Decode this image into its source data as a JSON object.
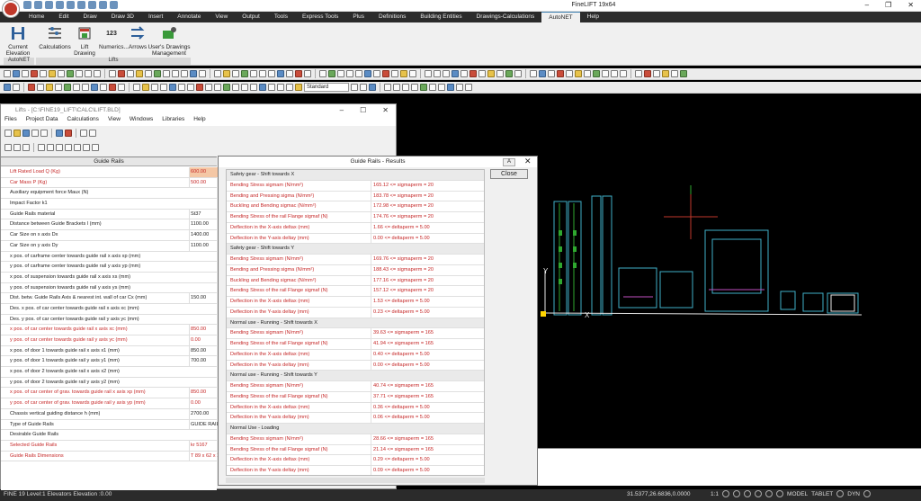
{
  "app": {
    "title": "FineLIFT 19x64"
  },
  "ribbon": {
    "tabs": [
      "Home",
      "Edit",
      "Draw",
      "Draw 3D",
      "Insert",
      "Annotate",
      "View",
      "Output",
      "Tools",
      "Express Tools",
      "Plus",
      "Definitions",
      "Building Entities",
      "Drawings-Calculations",
      "AutoNET",
      "Help"
    ],
    "active_tab": "AutoNET",
    "buttons": [
      "Current Elevation",
      "Calculations",
      "Lift Drawing",
      "Numerics...",
      "Arrows",
      "User's Drawings Management"
    ],
    "groups": [
      "AutoNET",
      "Lifts"
    ]
  },
  "toolbar": {
    "style_combo": "Standard"
  },
  "lifts_window": {
    "title": "Lifts - [C:\\FINE19_LIFT\\CALC\\LIFT.BLD]",
    "menu": [
      "Files",
      "Project Data",
      "Calculations",
      "View",
      "Windows",
      "Libraries",
      "Help"
    ],
    "panel_title": "Guide Rails",
    "rows": [
      {
        "label": "Lift Rated Load Q (Kg)",
        "value": "600.00"
      },
      {
        "label": "Car Mass P (Kg)",
        "value": "500.00"
      },
      {
        "label": "Auxiliary equipment force Maux (N)",
        "value": ""
      },
      {
        "label": "Impact Factor k1",
        "value": ""
      },
      {
        "label": "Guide Rails material",
        "value": "St37"
      },
      {
        "label": "Distance between Guide Brackets l (mm)",
        "value": "1100.00"
      },
      {
        "label": "Car Size on x axis Dx",
        "value": "1400.00"
      },
      {
        "label": "Car Size on y axis Dy",
        "value": "1100.00"
      },
      {
        "label": "x pos. of carframe center towards guide rail x axis xp (mm)",
        "value": ""
      },
      {
        "label": "y pos. of carframe center towards guide rail y axis yp (mm)",
        "value": ""
      },
      {
        "label": "x pos. of suspension towards guide rail x axis xs (mm)",
        "value": ""
      },
      {
        "label": "y pos. of suspension towards guide rail y axis ys (mm)",
        "value": ""
      },
      {
        "label": "Dist. betw. Guide Rails Axis & nearest int. wall of car Cx (mm)",
        "value": "150.00"
      },
      {
        "label": "Des. x pos. of car center towards guide rail x axis xc (mm)",
        "value": ""
      },
      {
        "label": "Des. y pos. of car center towards guide rail y axis yc (mm)",
        "value": ""
      },
      {
        "label": "x pos. of car center towards guide rail x axis xc (mm)",
        "value": "850.00"
      },
      {
        "label": "y pos. of car center towards guide rail y axis yc (mm)",
        "value": "0.00"
      },
      {
        "label": "x pos. of door 1 towards guide rail x axis x1 (mm)",
        "value": "850.00"
      },
      {
        "label": "y pos. of door 1 towards guide rail y axis y1 (mm)",
        "value": "700.00"
      },
      {
        "label": "x pos. of door 2 towards guide rail x axis x2 (mm)",
        "value": ""
      },
      {
        "label": "y pos. of door 2 towards guide rail y axis y2 (mm)",
        "value": ""
      },
      {
        "label": "x pos. of car center of grav. towards guide rail x axis xp (mm)",
        "value": "850.00"
      },
      {
        "label": "y pos. of car center of grav. towards guide rail y axis yp (mm)",
        "value": "0.00"
      },
      {
        "label": "Chassis vertical guiding distance h (mm)",
        "value": "2700.00"
      },
      {
        "label": "Type of Guide Rails",
        "value": "GUIDE RAILS"
      },
      {
        "label": "Desirable Guide Rails",
        "value": ""
      },
      {
        "label": "Selected Guide Rails",
        "value": "kr 5167"
      },
      {
        "label": "Guide Rails Dimensions",
        "value": "T 89 x 62 x 1"
      }
    ],
    "red_rows": [
      0,
      1,
      15,
      16,
      21,
      22,
      26,
      27
    ],
    "highlight_rows": [
      0
    ]
  },
  "results_window": {
    "title": "Guide Rails - Results",
    "font_button": "A",
    "close_label": "Close",
    "rows": [
      {
        "label": "Safety gear - Shift towards X",
        "value": "",
        "section": true
      },
      {
        "label": "Bending Stress sigmam (N/mm²)",
        "value": "165.12 <= sigmaperm = 20"
      },
      {
        "label": "Bending and Pressing sigma (N/mm²)",
        "value": "183.78 <= sigmaperm = 20"
      },
      {
        "label": "Buckling and Bending sigmac (N/mm²)",
        "value": "172.98 <= sigmaperm = 20"
      },
      {
        "label": "Bending Stress of the rail Flange sigmaf (N)",
        "value": "174.76 <= sigmaperm = 20"
      },
      {
        "label": "Deflection in the X-axis deltax (mm)",
        "value": "1.66 <= deltaperm = 5.00"
      },
      {
        "label": "Deflection in the Y-axis deltay (mm)",
        "value": "0.00 <= deltaperm = 5.00"
      },
      {
        "label": "Safety gear - Shift towards Y",
        "value": "",
        "section": true
      },
      {
        "label": "Bending Stress sigmam (N/mm²)",
        "value": "169.76 <= sigmaperm = 20"
      },
      {
        "label": "Bending and Pressing sigma (N/mm²)",
        "value": "188.43 <= sigmaperm = 20"
      },
      {
        "label": "Buckling and Bending sigmac (N/mm²)",
        "value": "177.16 <= sigmaperm = 20"
      },
      {
        "label": "Bending Stress of the rail Flange sigmaf (N)",
        "value": "157.12 <= sigmaperm = 20"
      },
      {
        "label": "Deflection in the X-axis deltax (mm)",
        "value": "1.53 <= deltaperm = 5.00"
      },
      {
        "label": "Deflection in the Y-axis deltay (mm)",
        "value": "0.23 <= deltaperm = 5.00"
      },
      {
        "label": "Normal use - Running - Shift towards X",
        "value": "",
        "section": true
      },
      {
        "label": "Bending Stress sigmam (N/mm²)",
        "value": "39.63 <= sigmaperm = 165"
      },
      {
        "label": "Bending Stress of the rail Flange sigmaf (N)",
        "value": "41.94 <= sigmaperm = 165"
      },
      {
        "label": "Deflection in the X-axis deltax (mm)",
        "value": "0.40 <= deltaperm = 5.00"
      },
      {
        "label": "Deflection in the Y-axis deltay (mm)",
        "value": "0.00 <= deltaperm = 5.00"
      },
      {
        "label": "Normal use - Running - Shift towards Y",
        "value": "",
        "section": true
      },
      {
        "label": "Bending Stress sigmam (N/mm²)",
        "value": "40.74 <= sigmaperm = 165"
      },
      {
        "label": "Bending Stress of the rail Flange sigmaf (N)",
        "value": "37.71 <= sigmaperm = 165"
      },
      {
        "label": "Deflection in the X-axis deltax (mm)",
        "value": "0.36 <= deltaperm = 5.00"
      },
      {
        "label": "Deflection in the Y-axis deltay (mm)",
        "value": "0.06 <= deltaperm = 5.00"
      },
      {
        "label": "Normal Use - Loading",
        "value": "",
        "section": true
      },
      {
        "label": "Bending Stress sigmam (N/mm²)",
        "value": "28.66 <= sigmaperm = 165"
      },
      {
        "label": "Bending Stress of the rail Flange sigmaf (N)",
        "value": "21.14 <= sigmaperm = 165"
      },
      {
        "label": "Deflection in the X-axis deltax (mm)",
        "value": "0.29 <= deltaperm = 5.00"
      },
      {
        "label": "Deflection in the Y-axis deltay (mm)",
        "value": "0.09 <= deltaperm = 5.00"
      }
    ]
  },
  "canvas": {
    "axis_y": "Y",
    "axis_x": "X"
  },
  "statusbar": {
    "left": "FINE 19 Level:1 Elevators Elevation :0.00",
    "coords": "31.5377,26.6836,0.0000",
    "model": "MODEL",
    "tablet": "TABLET",
    "dyn": "DYN",
    "scale": "1:1"
  },
  "colors": {
    "ribbon_dark": "#2b2b2b",
    "error_red": "#c62828",
    "canvas_bg": "#000000",
    "cad_cyan": "#3fb0c9",
    "cad_green": "#2fa82f",
    "cad_magenta": "#c050c0"
  }
}
